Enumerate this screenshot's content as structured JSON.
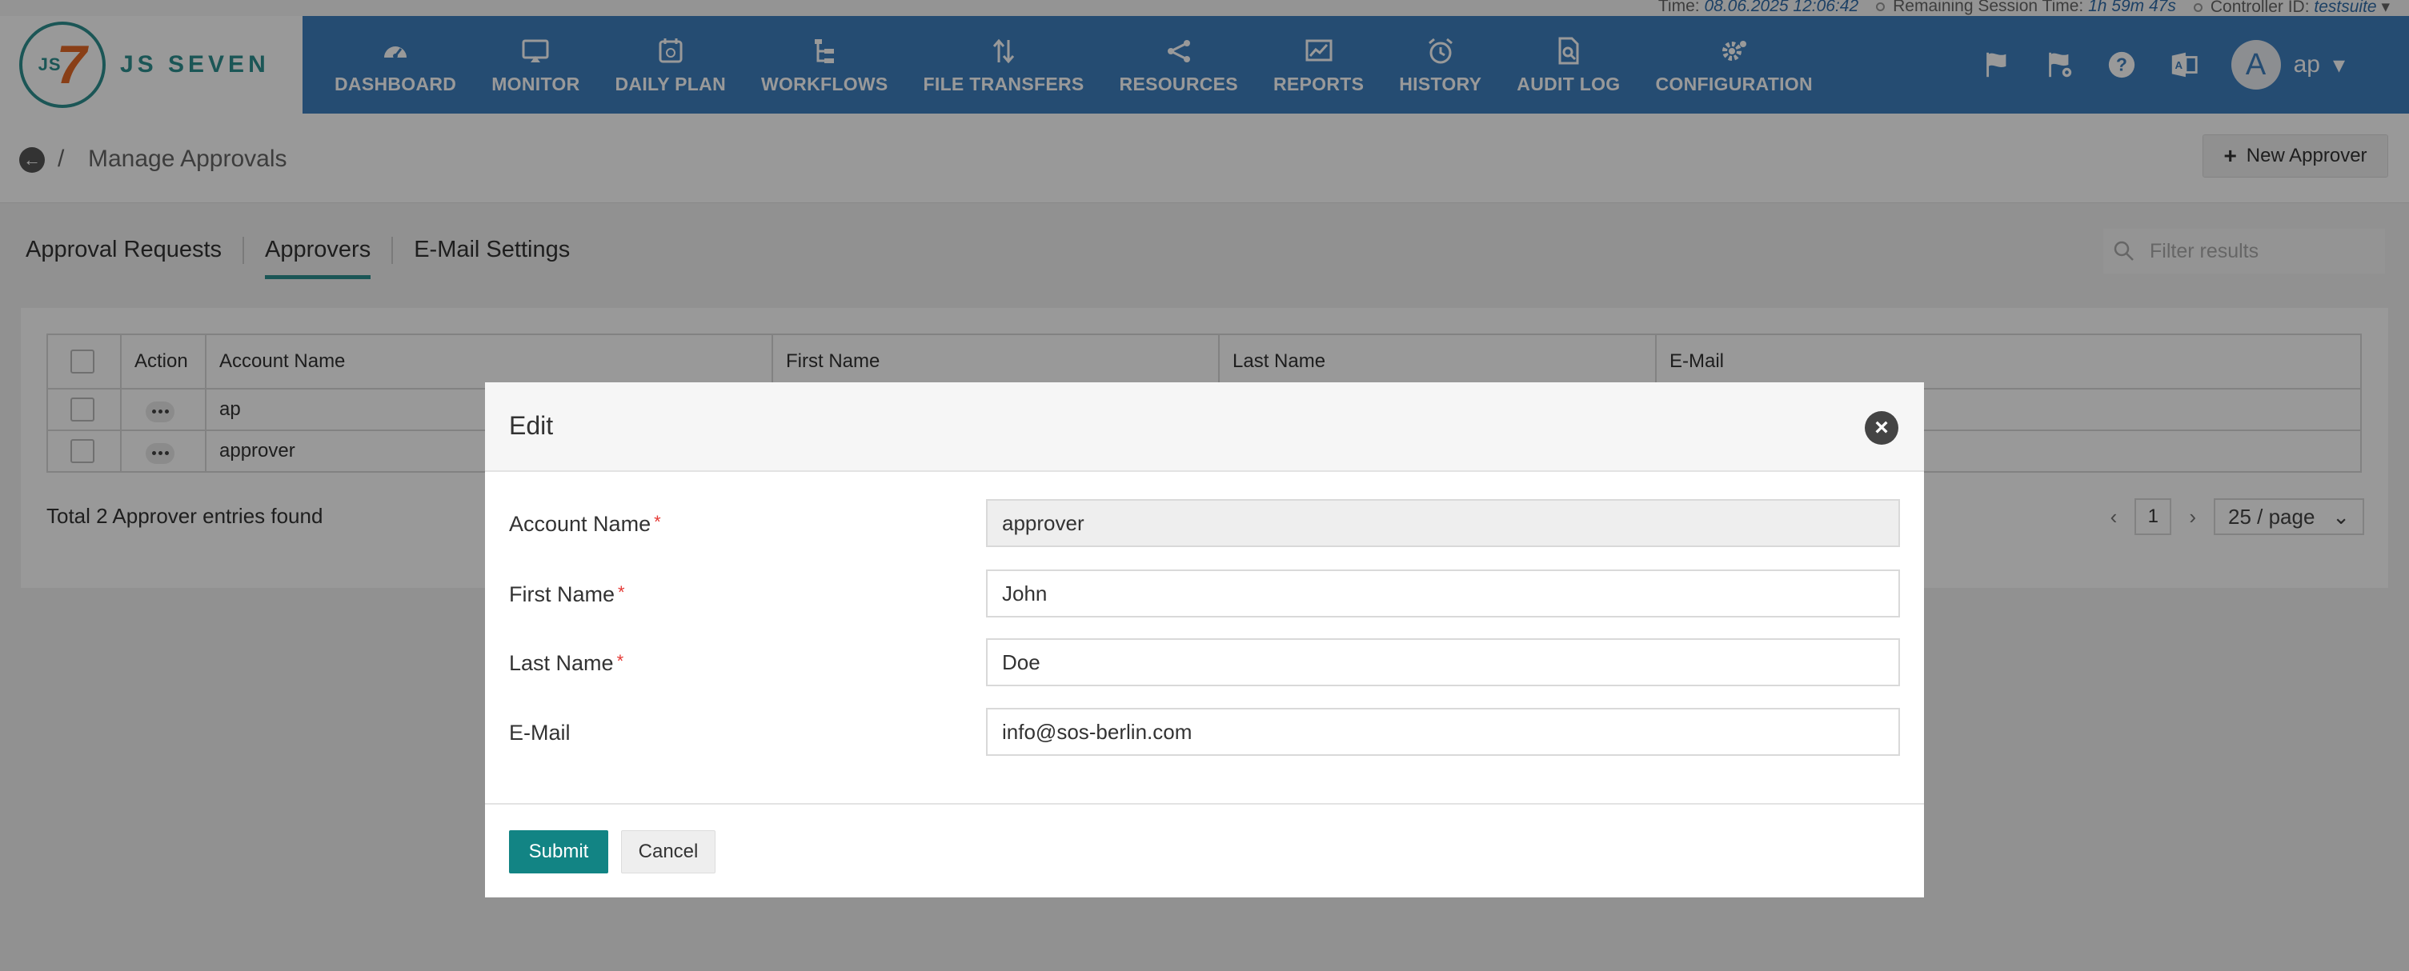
{
  "status": {
    "time_label": "Time:",
    "time_value": "08.06.2025 12:06:42",
    "session_label": "Remaining Session Time:",
    "session_value": "1h 59m 47s",
    "controller_label": "Controller ID:",
    "controller_value": "testsuite"
  },
  "brand": {
    "logo_mark": "JS",
    "logo_seven": "7",
    "name": "JS SEVEN"
  },
  "nav": [
    {
      "label": "DASHBOARD",
      "icon": "dashboard-icon"
    },
    {
      "label": "MONITOR",
      "icon": "monitor-icon"
    },
    {
      "label": "DAILY PLAN",
      "icon": "calendar-icon"
    },
    {
      "label": "WORKFLOWS",
      "icon": "workflow-icon"
    },
    {
      "label": "FILE TRANSFERS",
      "icon": "transfer-icon"
    },
    {
      "label": "RESOURCES",
      "icon": "share-icon"
    },
    {
      "label": "REPORTS",
      "icon": "chart-icon"
    },
    {
      "label": "HISTORY",
      "icon": "alarm-clock-icon"
    },
    {
      "label": "AUDIT LOG",
      "icon": "file-search-icon"
    },
    {
      "label": "CONFIGURATION",
      "icon": "gears-icon"
    }
  ],
  "user": {
    "avatar_letter": "A",
    "name": "ap"
  },
  "breadcrumb": {
    "separator": "/",
    "title": "Manage Approvals"
  },
  "toolbar": {
    "new_approver_label": "New Approver"
  },
  "tabs": [
    {
      "label": "Approval Requests",
      "active": false
    },
    {
      "label": "Approvers",
      "active": true
    },
    {
      "label": "E-Mail Settings",
      "active": false
    }
  ],
  "filter": {
    "placeholder": "Filter results"
  },
  "table": {
    "headers": [
      "Action",
      "Account Name",
      "First Name",
      "Last Name",
      "E-Mail"
    ],
    "rows": [
      {
        "account": "ap"
      },
      {
        "account": "approver"
      }
    ],
    "total_text": "Total 2 Approver entries found"
  },
  "pagination": {
    "page": "1",
    "page_size": "25 / page"
  },
  "modal": {
    "title": "Edit",
    "fields": [
      {
        "label": "Account Name",
        "value": "approver",
        "required": true
      },
      {
        "label": "First Name",
        "value": "John",
        "required": true
      },
      {
        "label": "Last Name",
        "value": "Doe",
        "required": true
      },
      {
        "label": "E-Mail",
        "value": "info@sos-berlin.com",
        "required": false
      }
    ],
    "required_mark": "*",
    "submit_label": "Submit",
    "cancel_label": "Cancel"
  },
  "colors": {
    "header": "#3f7fbf",
    "accent": "#128484",
    "logo_teal": "#2e8f8f",
    "logo_orange": "#e56a27",
    "required": "#e53935"
  }
}
